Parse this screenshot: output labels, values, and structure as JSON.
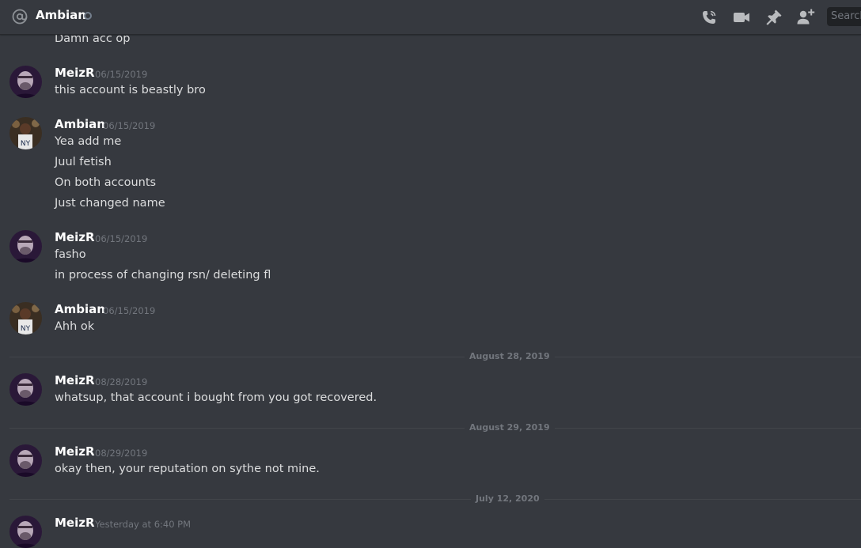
{
  "header": {
    "channel_title": "Ambian",
    "search_placeholder": "Search"
  },
  "colors": {
    "background": "#36393f",
    "header_text": "#ffffff",
    "message_text": "#dcddde",
    "muted": "#72767d",
    "divider": "#42454a",
    "icon": "#b9bbbe"
  },
  "messages": {
    "first_line": "Damn acc op",
    "g1": {
      "author": "MeizR",
      "time": "06/15/2019",
      "lines": [
        "this account is beastly bro"
      ]
    },
    "g2": {
      "author": "Ambian",
      "time": "06/15/2019",
      "lines": [
        "Yea add me",
        "Juul fetish",
        "On both accounts",
        "Just changed name"
      ]
    },
    "g3": {
      "author": "MeizR",
      "time": "06/15/2019",
      "lines": [
        "fasho",
        "in process of changing rsn/ deleting fl"
      ]
    },
    "g4": {
      "author": "Ambian",
      "time": "06/15/2019",
      "lines": [
        "Ahh ok"
      ]
    },
    "d1": "August 28, 2019",
    "g5": {
      "author": "MeizR",
      "time": "08/28/2019",
      "lines": [
        "whatsup, that account i bought from you got recovered."
      ]
    },
    "d2": "August 29, 2019",
    "g6": {
      "author": "MeizR",
      "time": "08/29/2019",
      "lines": [
        "okay then, your reputation on sythe not mine."
      ]
    },
    "d3": "July 12, 2020",
    "g7": {
      "author": "MeizR",
      "time": "Yesterday at 6:40 PM"
    }
  }
}
